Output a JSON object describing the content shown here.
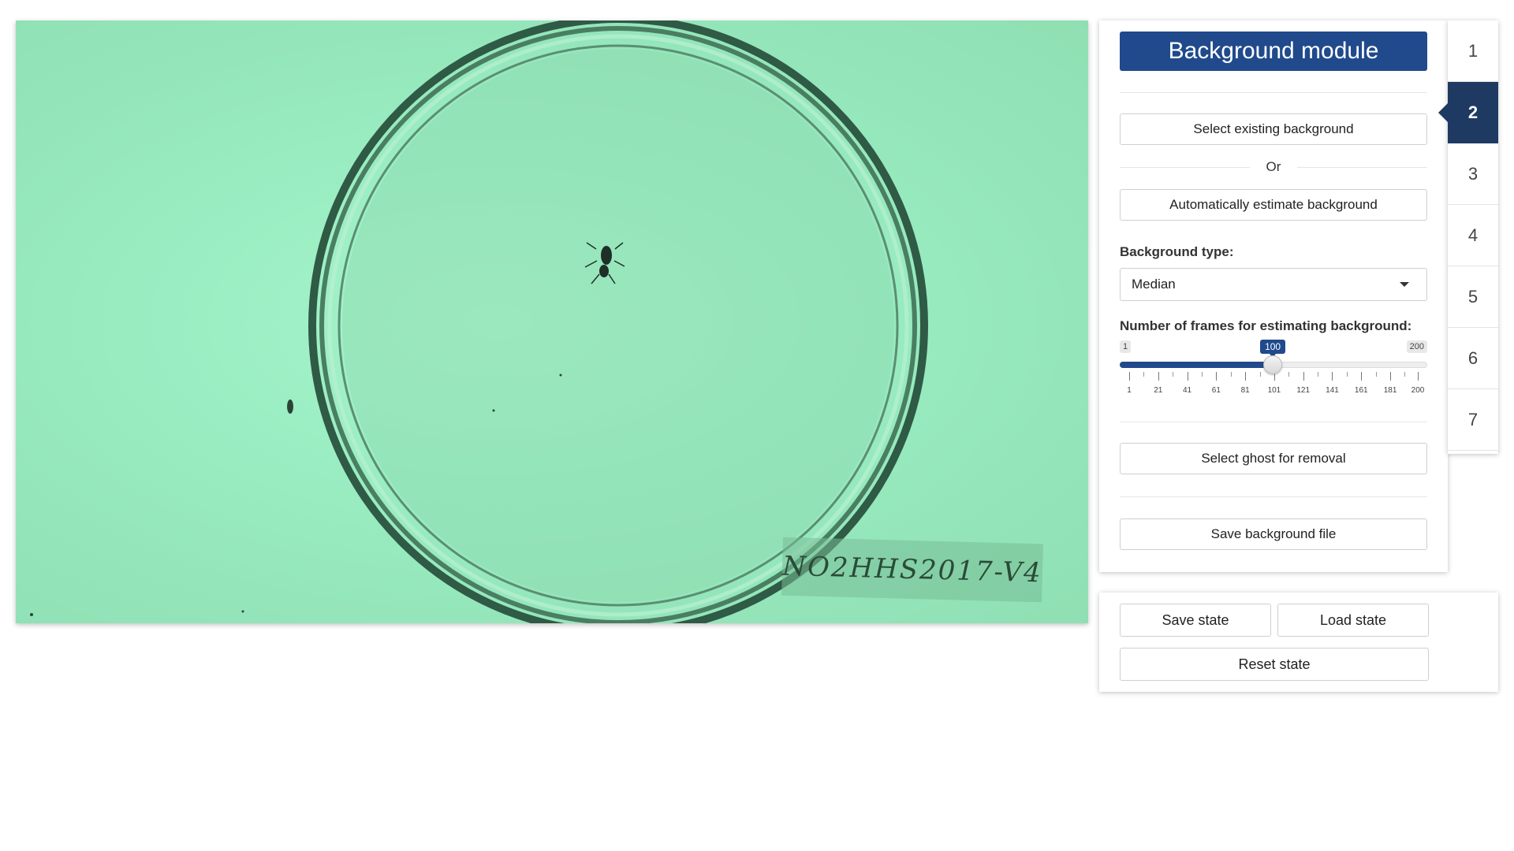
{
  "video": {
    "label_text": "NO2HHS2017-V4"
  },
  "module": {
    "title": "Background module",
    "select_existing_label": "Select existing background",
    "or_text": "Or",
    "auto_estimate_label": "Automatically estimate background",
    "background_type_label": "Background type:",
    "background_type_value": "Median",
    "frames_label": "Number of frames for estimating background:",
    "slider": {
      "min": 1,
      "max": 200,
      "value": 100,
      "min_text": "1",
      "max_text": "200",
      "value_text": "100",
      "tick_labels": [
        "1",
        "21",
        "41",
        "61",
        "81",
        "101",
        "121",
        "141",
        "161",
        "181",
        "200"
      ]
    },
    "ghost_label": "Select ghost for removal",
    "save_bg_label": "Save background file"
  },
  "steps": [
    "1",
    "2",
    "3",
    "4",
    "5",
    "6",
    "7"
  ],
  "active_step": 2,
  "state": {
    "save_label": "Save state",
    "load_label": "Load state",
    "reset_label": "Reset state"
  },
  "colors": {
    "accent": "#204a8c",
    "active_step": "#1e3a63",
    "video_tint": "#98ecc0"
  }
}
